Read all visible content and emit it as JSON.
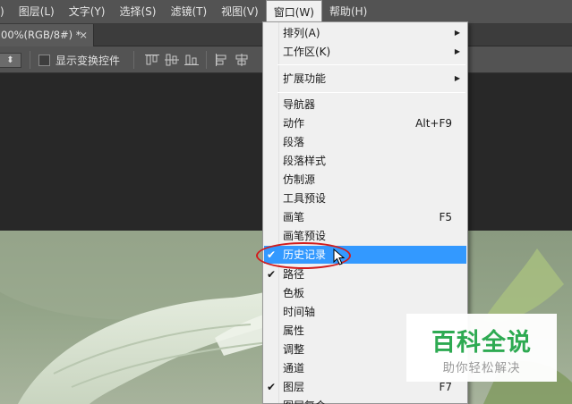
{
  "menubar": {
    "items": [
      {
        "label": ")"
      },
      {
        "label": "图层(L)"
      },
      {
        "label": "文字(Y)"
      },
      {
        "label": "选择(S)"
      },
      {
        "label": "滤镜(T)"
      },
      {
        "label": "视图(V)"
      },
      {
        "label": "窗口(W)"
      },
      {
        "label": "帮助(H)"
      }
    ]
  },
  "document_tab": {
    "title": "00%(RGB/8#) *",
    "close": "×"
  },
  "options_bar": {
    "stepper_glyph": "⬍",
    "show_transform_label": "显示变换控件",
    "show_transform_checked": false
  },
  "window_menu": {
    "top_items": [
      {
        "label": "排列(A)",
        "submenu": true
      },
      {
        "label": "工作区(K)",
        "submenu": true
      }
    ],
    "extensions": {
      "label": "扩展功能",
      "submenu": true
    },
    "panels": [
      {
        "label": "导航器",
        "shortcut": "",
        "checked": false
      },
      {
        "label": "动作",
        "shortcut": "Alt+F9",
        "checked": false
      },
      {
        "label": "段落",
        "shortcut": "",
        "checked": false
      },
      {
        "label": "段落样式",
        "shortcut": "",
        "checked": false
      },
      {
        "label": "仿制源",
        "shortcut": "",
        "checked": false
      },
      {
        "label": "工具预设",
        "shortcut": "",
        "checked": false
      },
      {
        "label": "画笔",
        "shortcut": "F5",
        "checked": false
      },
      {
        "label": "画笔预设",
        "shortcut": "",
        "checked": false
      },
      {
        "label": "历史记录",
        "shortcut": "",
        "checked": true,
        "highlighted": true
      },
      {
        "label": "路径",
        "shortcut": "",
        "checked": true
      },
      {
        "label": "色板",
        "shortcut": "",
        "checked": false
      },
      {
        "label": "时间轴",
        "shortcut": "",
        "checked": false
      },
      {
        "label": "属性",
        "shortcut": "",
        "checked": false
      },
      {
        "label": "调整",
        "shortcut": "",
        "checked": false
      },
      {
        "label": "通道",
        "shortcut": "",
        "checked": false
      },
      {
        "label": "图层",
        "shortcut": "F7",
        "checked": true
      },
      {
        "label": "图层复合",
        "shortcut": "",
        "checked": false
      }
    ],
    "check_glyph": "✔",
    "submenu_glyph": "▶"
  },
  "watermark": {
    "title": "百科全说",
    "subtitle": "助你轻松解决"
  },
  "colors": {
    "menu_highlight": "#3399ff",
    "annotation_red": "#d21c1c",
    "watermark_green": "#2eaa52"
  }
}
